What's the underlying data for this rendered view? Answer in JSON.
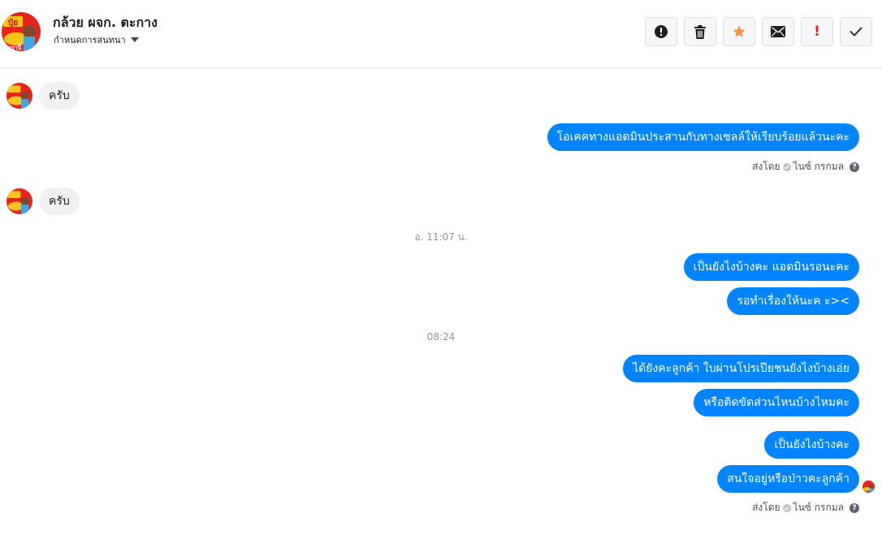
{
  "header": {
    "contact_name": "กล้วย ผจก. ตะกาง",
    "label_selector": "กำหนดการสนทนา",
    "actions": [
      {
        "name": "mark-spam-button",
        "icon": "exclamation-circle-icon"
      },
      {
        "name": "delete-button",
        "icon": "trash-icon"
      },
      {
        "name": "star-button",
        "icon": "star-icon"
      },
      {
        "name": "mark-unread-button",
        "icon": "envelope-icon"
      },
      {
        "name": "important-button",
        "icon": "exclamation-icon"
      },
      {
        "name": "done-button",
        "icon": "check-icon"
      }
    ]
  },
  "avatar": {
    "badge_text": "ปุ๋ย",
    "sub_text": "ตรานี้"
  },
  "messages": {
    "m1": "ครับ",
    "m2": "โอเคคทางแอดมินประสานกับทางเซลล์ให้เรียบร้อยแล้วนะคะ",
    "m3": "ครับ",
    "m4": "เป็นยังไงบ้างคะ แอดมินรอนะคะ",
    "m5": "รอทำเรื่องให้นะค ะ><",
    "m6": "ได้ยังคะลูกค้า ใบผ่านโปรเปียชนยังไงบ้างเอ่ย",
    "m7": "หรือติดขัดส่วนไหนบ้างไหมคะ",
    "m8": "เป็นยังไงบ้างคะ",
    "m9": "สนใจอยู่หรือป่าวคะลูกค้า"
  },
  "timestamps": {
    "t1": "อ. 11:07 น.",
    "t2": "08:24"
  },
  "seen": {
    "prefix": "ส่งโดย",
    "name": "ไนซ์ กรกมล",
    "help": "?"
  },
  "colors": {
    "outgoing": "#0084ff",
    "incoming": "#f1f0f0",
    "star": "#f7923a",
    "alert": "#e0201e"
  }
}
